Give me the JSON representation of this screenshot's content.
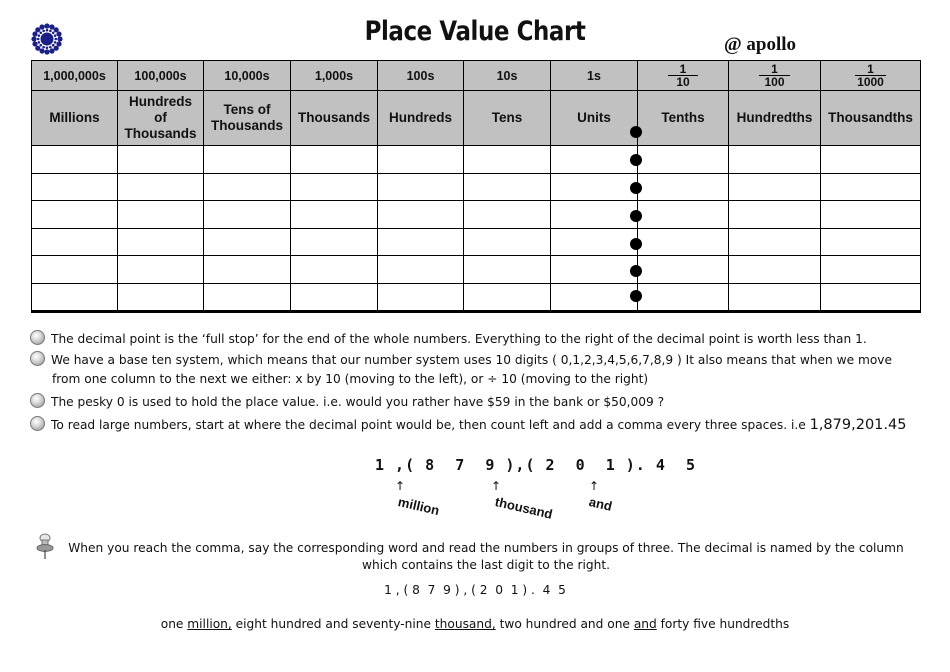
{
  "header": {
    "title": "Place Value Chart",
    "credit": "@ apollo",
    "logo_color": "#1a1f8a"
  },
  "table": {
    "place_values": [
      "1,000,000s",
      "100,000s",
      "10,000s",
      "1,000s",
      "100s",
      "10s",
      "1s"
    ],
    "fractions": [
      {
        "num": "1",
        "den": "10"
      },
      {
        "num": "1",
        "den": "100"
      },
      {
        "num": "1",
        "den": "1000"
      }
    ],
    "names": [
      "Millions",
      "Hundreds of Thousands",
      "Tens of Thousands",
      "Thousands",
      "Hundreds",
      "Tens",
      "Units",
      "Tenths",
      "Hundredths",
      "Thousandths"
    ],
    "names_lines": [
      [
        "Millions"
      ],
      [
        "Hundreds",
        "of",
        "Thousands"
      ],
      [
        "Tens of",
        "Thousands"
      ],
      [
        "Thousands"
      ],
      [
        "Hundreds"
      ],
      [
        "Tens"
      ],
      [
        "Units"
      ],
      [
        "Tenths"
      ],
      [
        "Hundredths"
      ],
      [
        "Thousandths"
      ]
    ],
    "empty_rows": 6,
    "header_color": "#c0c1c0"
  },
  "notes": [
    "The decimal point is the ‘full stop’ for the end of the whole numbers.  Everything to the right of the decimal point is worth less than 1.",
    "We have a base ten system, which means that our number system uses 10 digits ( 0,1,2,3,4,5,6,7,8,9 ) It also means that when we move",
    "from one column to the next we either:   x  by 10 (moving to the left),  or  ÷ 10 (moving to the right)",
    "The pesky 0 is used to hold the place value.  i.e. would you rather have $59 in the bank or $50,009 ?",
    "To read large numbers, start at where the decimal point would be, then count left and add a comma every three spaces. i.e"
  ],
  "example_number": "1,879,201.45",
  "grouped_example": "1 ,( 8  7  9 ),( 2  0  1 ). 4  5",
  "group_labels": [
    "million",
    "thousand",
    "and"
  ],
  "reading_tip": {
    "line1": "When you reach the comma, say the corresponding word and read the numbers in groups of three. The decimal is named by the column",
    "line2": "which contains the last digit to the right."
  },
  "grouped_example_small": "1 , ( 8  7  9 ) , ( 2  0  1 ) .  4  5",
  "words": {
    "p1": "one ",
    "u1": "million,",
    "p2": " eight hundred and seventy-nine ",
    "u2": "thousand,",
    "p3": " two hundred and one ",
    "u3": "and",
    "p4": " forty five hundredths"
  }
}
